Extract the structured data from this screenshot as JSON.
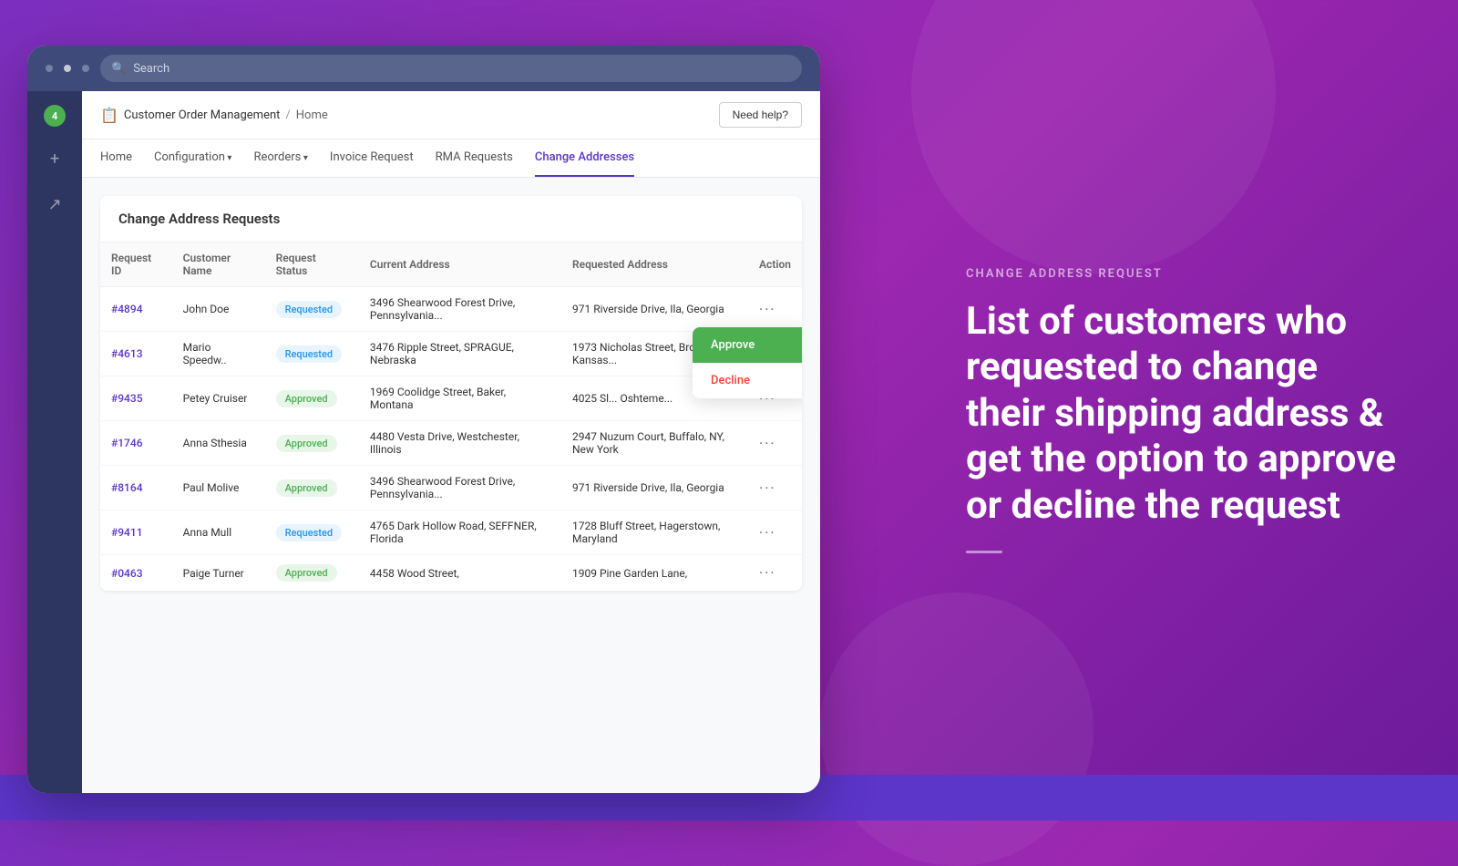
{
  "browser": {
    "search_placeholder": "Search",
    "dots": [
      "dot1",
      "dot2",
      "dot3"
    ]
  },
  "sidebar": {
    "badge_count": "4",
    "icons": [
      "+",
      "↗"
    ]
  },
  "header": {
    "app_icon": "📋",
    "app_name": "Customer Order Management",
    "separator": "/",
    "home_label": "Home",
    "help_button": "Need help?"
  },
  "nav": {
    "items": [
      {
        "label": "Home",
        "active": false,
        "has_arrow": false
      },
      {
        "label": "Configuration",
        "active": false,
        "has_arrow": true
      },
      {
        "label": "Reorders",
        "active": false,
        "has_arrow": true
      },
      {
        "label": "Invoice Request",
        "active": false,
        "has_arrow": false
      },
      {
        "label": "RMA Requests",
        "active": false,
        "has_arrow": false
      },
      {
        "label": "Change Addresses",
        "active": true,
        "has_arrow": false
      }
    ]
  },
  "table": {
    "title": "Change Address Requests",
    "columns": [
      "Request ID",
      "Customer Name",
      "Request Status",
      "Current Address",
      "Requested Address",
      "Action"
    ],
    "rows": [
      {
        "id": "#4894",
        "name": "John Doe",
        "status": "Requested",
        "status_type": "requested",
        "current_address": "3496 Shearwood Forest Drive, Pennsylvania...",
        "requested_address": "971 Riverside Drive, Ila, Georgia",
        "show_dropdown": false
      },
      {
        "id": "#4613",
        "name": "Mario Speedw..",
        "status": "Requested",
        "status_type": "requested",
        "current_address": "3476 Ripple Street, SPRAGUE, Nebraska",
        "requested_address": "1973 Nicholas Street, Brookville, Kansas...",
        "show_dropdown": true
      },
      {
        "id": "#9435",
        "name": "Petey Cruiser",
        "status": "Approved",
        "status_type": "approved",
        "current_address": "1969 Coolidge Street, Baker, Montana",
        "requested_address": "4025 Sl... Oshteme...",
        "show_dropdown": false
      },
      {
        "id": "#1746",
        "name": "Anna Sthesia",
        "status": "Approved",
        "status_type": "approved",
        "current_address": "4480 Vesta Drive, Westchester, Illinois",
        "requested_address": "2947 Nuzum Court, Buffalo, NY, New York",
        "show_dropdown": false
      },
      {
        "id": "#8164",
        "name": "Paul Molive",
        "status": "Approved",
        "status_type": "approved",
        "current_address": "3496 Shearwood Forest Drive, Pennsylvania...",
        "requested_address": "971 Riverside Drive, Ila, Georgia",
        "show_dropdown": false
      },
      {
        "id": "#9411",
        "name": "Anna Mull",
        "status": "Requested",
        "status_type": "requested",
        "current_address": "4765 Dark Hollow Road, SEFFNER, Florida",
        "requested_address": "1728 Bluff Street, Hagerstown, Maryland",
        "show_dropdown": false
      },
      {
        "id": "#0463",
        "name": "Paige Turner",
        "status": "Approved",
        "status_type": "approved",
        "current_address": "4458 Wood Street,",
        "requested_address": "1909 Pine Garden Lane,",
        "show_dropdown": false
      }
    ]
  },
  "dropdown": {
    "approve_label": "Approve",
    "decline_label": "Decline"
  },
  "right_panel": {
    "label": "CHANGE ADDRESS REQUEST",
    "title": "List of customers who requested to change their shipping address & get the option to approve or decline the request"
  }
}
